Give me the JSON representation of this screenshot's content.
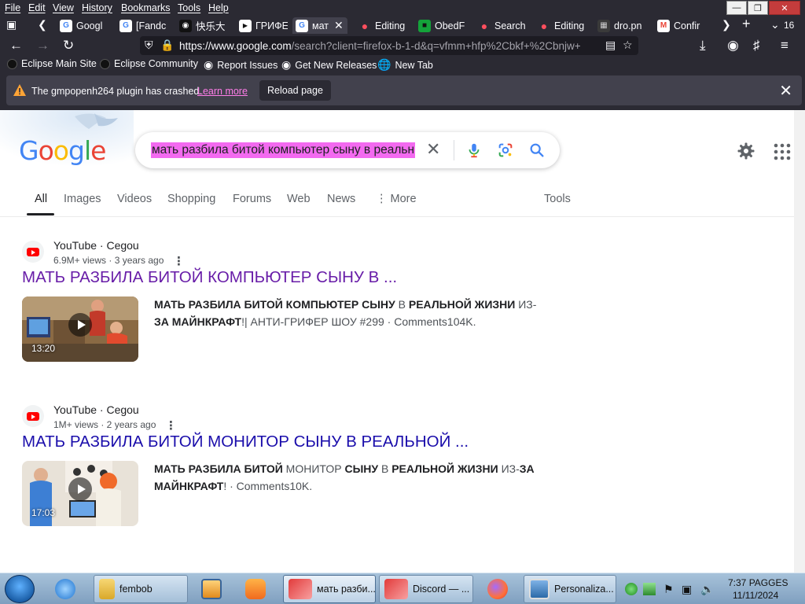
{
  "menubar": {
    "items": [
      "File",
      "Edit",
      "View",
      "History",
      "Bookmarks",
      "Tools",
      "Help"
    ]
  },
  "tabs": [
    {
      "label": "Googl",
      "icon": "google-icon"
    },
    {
      "label": "[Fandc",
      "icon": "google-icon"
    },
    {
      "label": "快乐大",
      "icon": "cat-icon"
    },
    {
      "label": "ГРИФЕ",
      "icon": "youtube-icon"
    },
    {
      "label": "мат",
      "icon": "google-icon",
      "active": true
    },
    {
      "label": "Editing",
      "icon": "fire-icon"
    },
    {
      "label": "ObedF",
      "icon": "green-square-icon"
    },
    {
      "label": "Search",
      "icon": "fire-icon"
    },
    {
      "label": "Editing",
      "icon": "fire-icon"
    },
    {
      "label": "dro.pn",
      "icon": "image-icon"
    },
    {
      "label": "Confir",
      "icon": "gmail-icon"
    }
  ],
  "tab_count": "16",
  "address_bar": {
    "url_host": "https://www.google.com",
    "url_rest": "/search?client=firefox-b-1-d&q=vfmm+hfp%2Cbkf+%2Cbnjw+"
  },
  "bookmarks": [
    {
      "label": "Eclipse Main Site",
      "icon": "eclipse-icon"
    },
    {
      "label": "Eclipse Community",
      "icon": "eclipse-icon"
    },
    {
      "label": "Report Issues",
      "icon": "github-icon"
    },
    {
      "label": "Get New Releases",
      "icon": "github-icon"
    },
    {
      "label": "New Tab",
      "icon": "globe-icon"
    }
  ],
  "notification": {
    "message": "The gmpopenh264 plugin has crashed.",
    "link": "Learn more",
    "button": "Reload page"
  },
  "google": {
    "logo_letters": [
      "G",
      "o",
      "o",
      "g",
      "l",
      "e"
    ],
    "logo_colors": [
      "#4285f4",
      "#ea4335",
      "#fbbc05",
      "#4285f4",
      "#34a853",
      "#ea4335"
    ],
    "query": "мать разбила битой компьютер сыну в реальн",
    "tabs": [
      "All",
      "Images",
      "Videos",
      "Shopping",
      "Forums",
      "Web",
      "News",
      "More",
      "Tools"
    ],
    "active_tab": "All"
  },
  "results": [
    {
      "source": "YouTube · Cegou",
      "meta": "6.9M+ views · 3 years ago",
      "title": "МАТЬ РАЗБИЛА БИТОЙ КОМПЬЮТЕР СЫНУ В ...",
      "title_color": "#681da8",
      "duration": "13:20",
      "snippet_parts": [
        {
          "text": "МАТЬ РАЗБИЛА БИТОЙ КОМПЬЮТЕР СЫНУ",
          "bold": true
        },
        {
          "text": " В ",
          "bold": false
        },
        {
          "text": "РЕАЛЬНОЙ ЖИЗНИ",
          "bold": true
        },
        {
          "text": " ИЗ-",
          "bold": false
        },
        {
          "text": "ЗА МАЙНКРАФТ",
          "bold": true
        },
        {
          "text": "!| АНТИ-ГРИФЕР ШОУ #299 · Comments104K.",
          "bold": false
        }
      ]
    },
    {
      "source": "YouTube · Cegou",
      "meta": "1M+ views · 2 years ago",
      "title": "МАТЬ РАЗБИЛА БИТОЙ МОНИТОР СЫНУ В РЕАЛЬНОЙ ...",
      "title_color": "#1a0dab",
      "duration": "17:03",
      "snippet_parts": [
        {
          "text": "МАТЬ РАЗБИЛА БИТОЙ",
          "bold": true
        },
        {
          "text": " МОНИТОР ",
          "bold": false
        },
        {
          "text": "СЫНУ",
          "bold": true
        },
        {
          "text": " В ",
          "bold": false
        },
        {
          "text": "РЕАЛЬНОЙ ЖИЗНИ",
          "bold": true
        },
        {
          "text": " ИЗ-",
          "bold": false
        },
        {
          "text": "ЗА МАЙНКРАФТ",
          "bold": true
        },
        {
          "text": "! · Comments10K.",
          "bold": false
        }
      ]
    }
  ],
  "taskbar": {
    "items": [
      {
        "label": "",
        "icon": "internet-explorer-icon"
      },
      {
        "label": "fembob",
        "icon": "folder-icon"
      },
      {
        "label": "",
        "icon": "media-player-icon"
      },
      {
        "label": "",
        "icon": "uc-browser-icon"
      },
      {
        "label": "мать разби...",
        "icon": "red-envelope-icon"
      },
      {
        "label": "Discord — ...",
        "icon": "red-envelope-icon"
      },
      {
        "label": "",
        "icon": "firefox-icon"
      },
      {
        "label": "Personaliza...",
        "icon": "monitor-icon"
      }
    ],
    "clock_time": "7:37 PAGGES",
    "clock_date": "11/11/2024"
  }
}
